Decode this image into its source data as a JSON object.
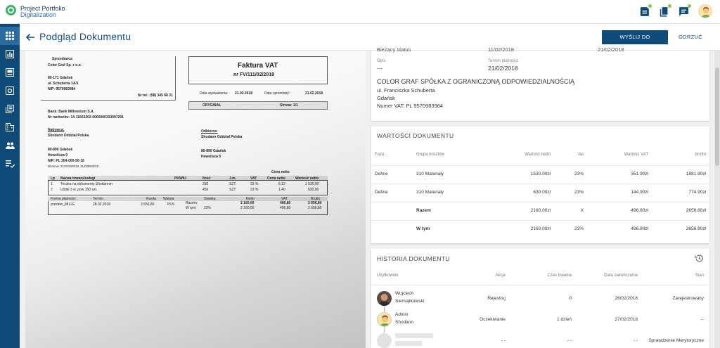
{
  "app": {
    "brand_line1": "Project Portfolio",
    "brand_line2": "Digitalization"
  },
  "topbar_icons": [
    "documents-icon",
    "copy-icon",
    "chat-icon"
  ],
  "sidebar": {
    "items": [
      "apps-icon",
      "chart-icon",
      "inbox-icon",
      "settings-box-icon",
      "library-icon",
      "building-icon",
      "people-icon",
      "list-icon"
    ]
  },
  "page": {
    "title": "Podgląd Dokumentu",
    "send_button": "WYŚLIJ DO WERYFIKACJI",
    "reject_button": "ODRZUĆ"
  },
  "details": {
    "cut_label_1": "Bieżący status",
    "cut_value_2": "11/02/2018",
    "cut_value_3": "21/02/2018",
    "opis_label": "Opis",
    "opis_value": "---",
    "payment_label": "Termin płatności",
    "payment_value": "21/02/2018",
    "company_name": "COLOR GRAF SPÓŁKA Z OGRANICZONĄ ODPOWIEDZIALNOŚCIĄ",
    "street": "ul. Franciszka Schuberta",
    "city": "Gdańsk",
    "vat": "Numer VAT: PL 9570983984"
  },
  "values_table": {
    "title": "WARTOŚCI DOKUMENTU",
    "headers": [
      "Faza",
      "Grupa kosztów",
      "Wartość netto",
      "Vat",
      "Wartość VAT",
      "brutto"
    ],
    "rows": [
      [
        "Define",
        "310 Materiały",
        "1530.00zł",
        "23%",
        "351.90zł",
        "1881.90zł"
      ],
      [
        "Define",
        "310 Materiały",
        "630.00zł",
        "23%",
        "144.90zł",
        "774.90zł"
      ],
      [
        "",
        "Razem",
        "2160.00zł",
        "X",
        "496.80zł",
        "2656.80zł"
      ],
      [
        "",
        "W tym",
        "2160.00zł",
        "23%",
        "496.80zł",
        "2656.80zł"
      ]
    ]
  },
  "history": {
    "title": "HISTORIA DOKUMENTU",
    "headers": [
      "Użytkownik",
      "Akcja",
      "Czas trwania",
      "Data zakończenia",
      "Stan"
    ],
    "rows": [
      {
        "user_line1": "Wojciech",
        "user_line2": "Siemiątkowski",
        "action": "Rejestruj",
        "duration": "0",
        "date": "26/02/2018",
        "state": "Zarejestrowany"
      },
      {
        "user_line1": "Admin",
        "user_line2": "Shodann",
        "action": "Oczekiwanie",
        "duration": "1 dzień",
        "date": "27/02/2018",
        "state": "--"
      },
      {
        "user_line1": "",
        "user_line2": "",
        "action": "- -",
        "duration": "- -",
        "date": "- -",
        "state": "Sprawdzenie Merytoryczne"
      }
    ]
  },
  "invoice": {
    "seller_label": "Sprzedawca",
    "seller_name": "Color Graf Sp. z o.o.",
    "seller_addr1": "80-171 Gdańsk",
    "seller_addr2": "ul. Schuberta 1A/1",
    "seller_nip": "NIP: 9570983984",
    "seller_tel": "Nr tel.: (58) 345 68 31",
    "title": "Faktura VAT",
    "number": "nr FV/111/02/2018",
    "issue_label": "Data wystawienia:",
    "issue_date": "21.02.2018",
    "sale_label": "Data sprzedaży:",
    "sale_date": "21.02.2018",
    "original": "ORYGINAŁ",
    "page_label": "Strona: 1/1",
    "bank": "Bank: Bank Millennium S.A.",
    "account": "Nr rachunku: 14-11602202-0000000333097291",
    "buyer_label": "Nabywca:",
    "buyer_name": "Shodann Oddział Polska",
    "receiver_label": "Odbiorca:",
    "receiver_name": "Shodann Oddział Polska",
    "buyer_city": "80-890 Gdańsk",
    "buyer_street": "Hewelisza 9",
    "buyer_nip": "NIP: PL 204-000-50-16",
    "buyer_order": "Zlecenie: ZL/0319/2018, ZL/0289/2018",
    "receiver_city": "80-890 Gdańsk",
    "receiver_street": "Hewelisza 9",
    "cena_netto": "Cena netto",
    "item_headers": [
      "Lp",
      "Nazwa towaru/usługi",
      "PKWiU",
      "Ilość",
      "J.m.",
      "VAT",
      "Cena netto",
      "Wartość netto"
    ],
    "items": [
      [
        "1",
        "Teczka na dokumenty Shodannm",
        "",
        "250",
        "SZT",
        "23 %",
        "6,12",
        "1 530,00"
      ],
      [
        "2",
        "Ulotki 3 w. pow 150 szt.",
        "",
        "450",
        "SZT",
        "23 %",
        "1,40",
        "630,00"
      ]
    ],
    "pay_headers": [
      "Forma płatności",
      "Termin",
      "Kwota",
      "Waluta",
      "Stawka",
      "Netto",
      "VAT",
      "Brutto"
    ],
    "pay_method": "przelew_MILLE",
    "pay_date": "28.02.2018",
    "pay_amount": "2 656,80",
    "pay_currency": "PLN",
    "razem_label": "Razem:",
    "wtym_label": "W tym:",
    "wtym_rate": "23%",
    "sum_netto": "2 160,00",
    "sum_vat": "496,80",
    "sum_brutto": "2 656,80"
  }
}
